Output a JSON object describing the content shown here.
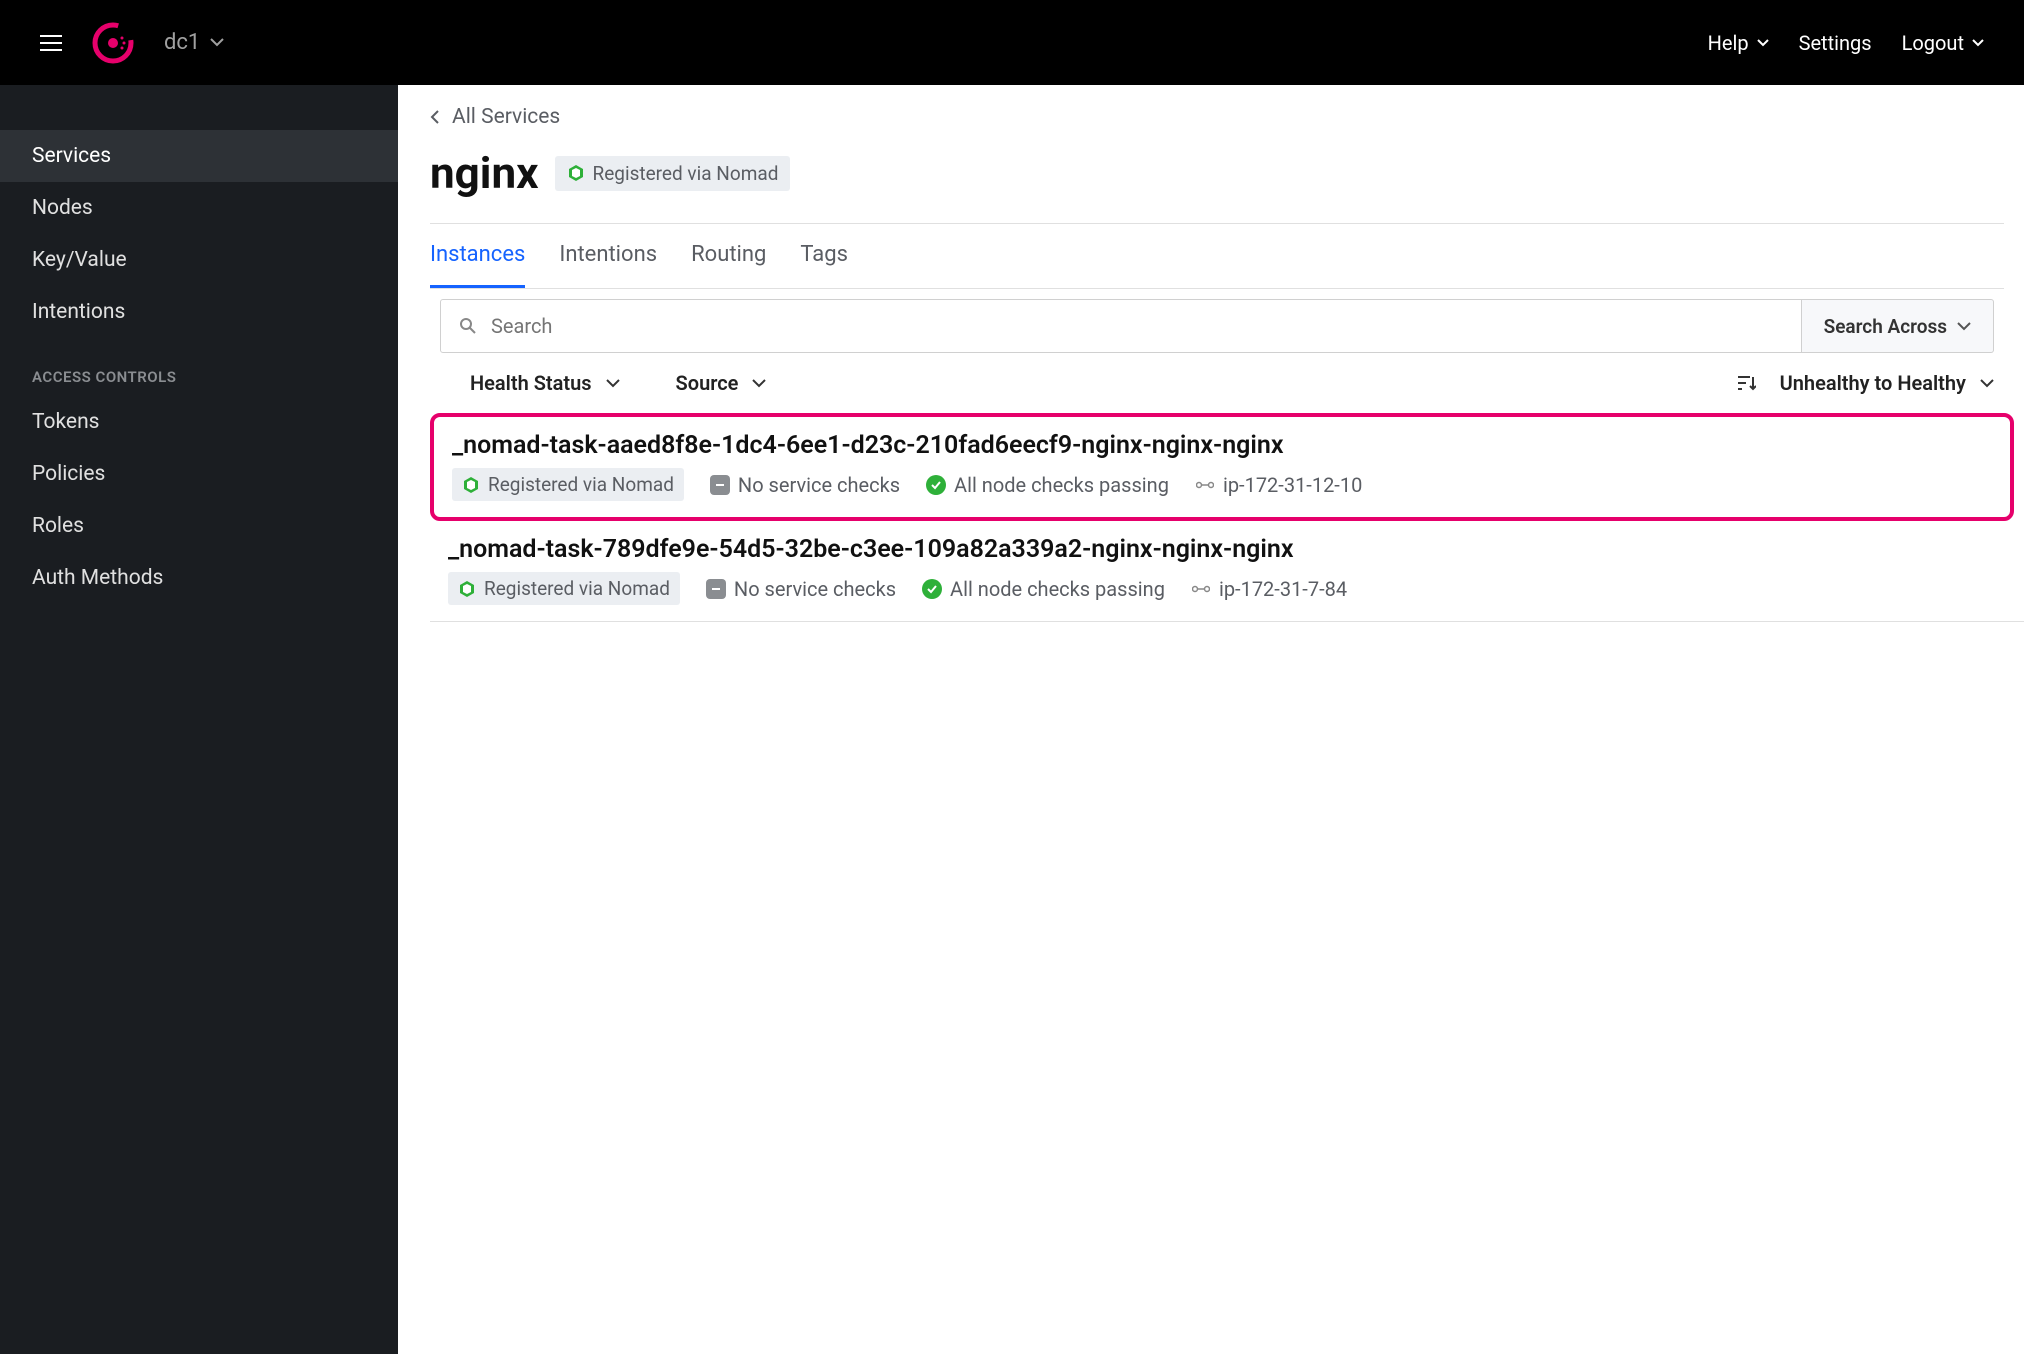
{
  "header": {
    "datacenter": "dc1",
    "help": "Help",
    "settings": "Settings",
    "logout": "Logout"
  },
  "sidebar": {
    "items": [
      {
        "label": "Services",
        "active": true
      },
      {
        "label": "Nodes"
      },
      {
        "label": "Key/Value"
      },
      {
        "label": "Intentions"
      }
    ],
    "access_heading": "ACCESS CONTROLS",
    "access_items": [
      {
        "label": "Tokens"
      },
      {
        "label": "Policies"
      },
      {
        "label": "Roles"
      },
      {
        "label": "Auth Methods"
      }
    ]
  },
  "main": {
    "breadcrumb": "All Services",
    "title": "nginx",
    "title_badge": "Registered via Nomad",
    "tabs": [
      {
        "label": "Instances",
        "active": true
      },
      {
        "label": "Intentions"
      },
      {
        "label": "Routing"
      },
      {
        "label": "Tags"
      }
    ],
    "search_placeholder": "Search",
    "search_across": "Search Across",
    "filter_health": "Health Status",
    "filter_source": "Source",
    "sort_label": "Unhealthy to Healthy",
    "instances": [
      {
        "name": "_nomad-task-aaed8f8e-1dc4-6ee1-d23c-210fad6eecf9-nginx-nginx-nginx",
        "badge": "Registered via Nomad",
        "service_checks": "No service checks",
        "node_checks": "All node checks passing",
        "node": "ip-172-31-12-10",
        "highlighted": true
      },
      {
        "name": "_nomad-task-789dfe9e-54d5-32be-c3ee-109a82a339a2-nginx-nginx-nginx",
        "badge": "Registered via Nomad",
        "service_checks": "No service checks",
        "node_checks": "All node checks passing",
        "node": "ip-172-31-7-84",
        "highlighted": false
      }
    ]
  }
}
